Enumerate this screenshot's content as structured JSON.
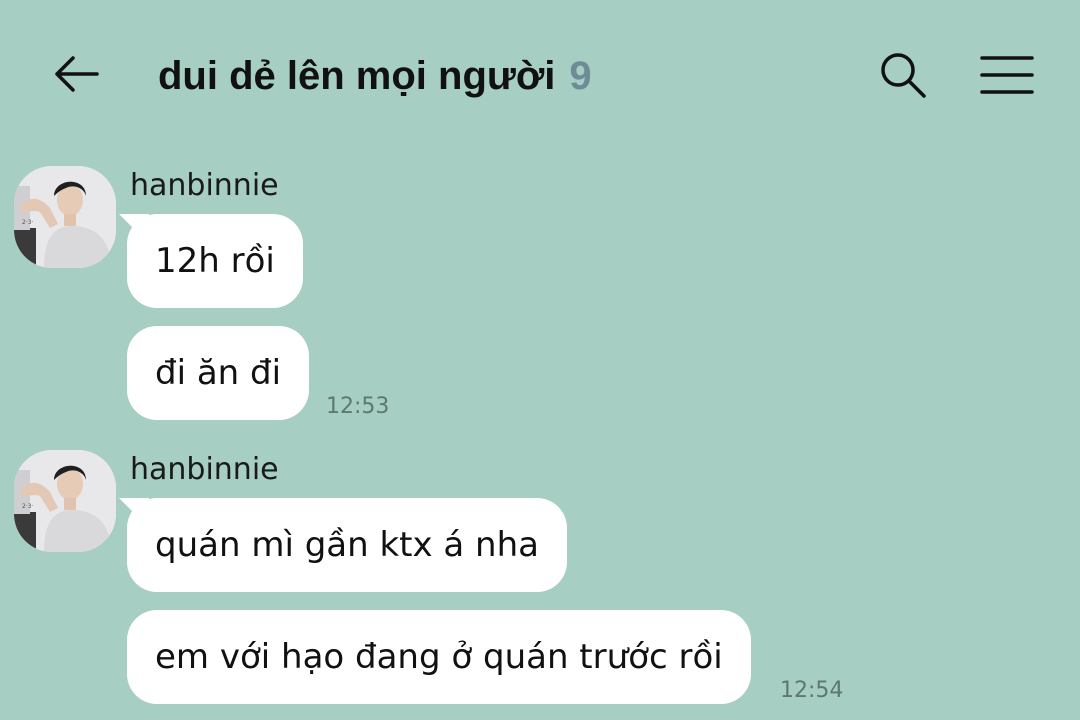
{
  "header": {
    "title": "dui dẻ lên mọi người",
    "member_count": "9"
  },
  "messages": [
    {
      "sender": "hanbinnie",
      "bubbles": [
        "12h rồi",
        "đi ăn đi"
      ],
      "time": "12:53"
    },
    {
      "sender": "hanbinnie",
      "bubbles": [
        "quán mì gần ktx á nha",
        "em với hạo đang ở quán trước rồi"
      ],
      "time": "12:54"
    }
  ],
  "icons": {
    "back": "arrow-left-icon",
    "search": "search-icon",
    "menu": "hamburger-menu-icon"
  },
  "colors": {
    "background": "#a6cec2",
    "bubble": "#ffffff",
    "member_count": "#6f8b95",
    "timestamp": "#5d7771"
  }
}
